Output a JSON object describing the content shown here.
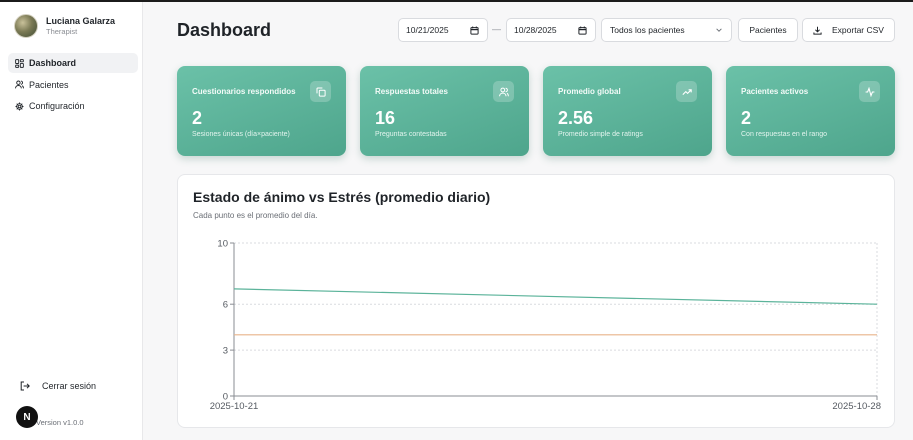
{
  "profile": {
    "name": "Luciana Galarza",
    "role": "Therapist"
  },
  "nav": [
    {
      "label": "Dashboard",
      "icon": "dashboard-icon",
      "active": true
    },
    {
      "label": "Pacientes",
      "icon": "users-icon",
      "active": false
    },
    {
      "label": "Configuración",
      "icon": "gear-icon",
      "active": false
    }
  ],
  "sidebar_footer": {
    "logout_label": "Cerrar sesión",
    "version": "Version v1.0.0",
    "badge": "N"
  },
  "header": {
    "title": "Dashboard",
    "date_from": "10/21/2025",
    "date_sep": "—",
    "date_to": "10/28/2025",
    "patient_select": "Todos los pacientes",
    "patients_button": "Pacientes",
    "export_button": "Exportar CSV"
  },
  "cards": [
    {
      "title": "Cuestionarios respondidos",
      "value": "2",
      "subtitle": "Sesiones únicas (día×paciente)",
      "icon": "copy-icon"
    },
    {
      "title": "Respuestas totales",
      "value": "16",
      "subtitle": "Preguntas contestadas",
      "icon": "users-icon"
    },
    {
      "title": "Promedio global",
      "value": "2.56",
      "subtitle": "Promedio simple de ratings",
      "icon": "trending-up-icon"
    },
    {
      "title": "Pacientes activos",
      "value": "2",
      "subtitle": "Con respuestas en el rango",
      "icon": "activity-icon"
    }
  ],
  "colors": {
    "accent": "#5bb39a",
    "mood": "#5bb39a",
    "stress": "#e8b48a"
  },
  "panel": {
    "title": "Estado de ánimo vs Estrés (promedio diario)",
    "subtitle": "Cada punto es el promedio del día."
  },
  "chart_data": {
    "type": "line",
    "x": [
      "2025-10-21",
      "2025-10-28"
    ],
    "series": [
      {
        "values": [
          7.0,
          6.0
        ],
        "color": "#5bb39a"
      },
      {
        "values": [
          4.0,
          4.0
        ],
        "color": "#e8b48a"
      }
    ],
    "yticks": [
      0,
      3,
      6,
      10
    ],
    "ylim": [
      0,
      10
    ],
    "grid": true
  }
}
